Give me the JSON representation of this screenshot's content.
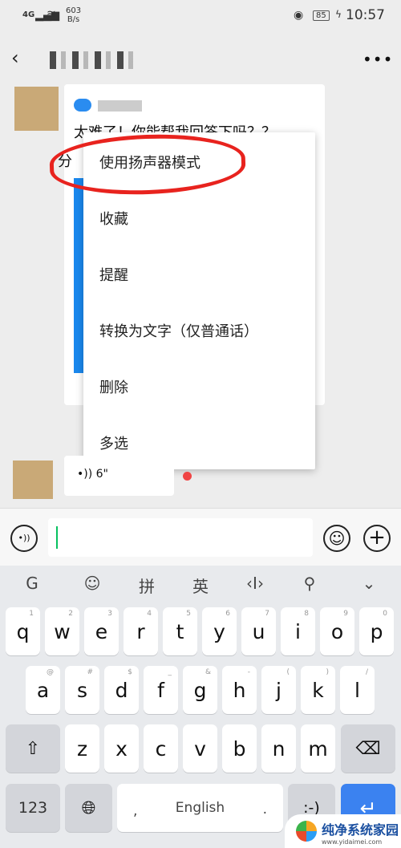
{
  "status_bar": {
    "network": "4G",
    "speed_value": "603",
    "speed_unit": "B/s",
    "battery": "85",
    "time": "10:57"
  },
  "header": {
    "back_icon": "chevron-left",
    "more_icon": "more-horizontal"
  },
  "chat": {
    "message_text": "太难了！你能帮我回答下吗？？",
    "message_prefix": "分",
    "voice_duration": "6\"",
    "unread_dot_color": "#f04545"
  },
  "context_menu": {
    "items": [
      "使用扬声器模式",
      "收藏",
      "提醒",
      "转换为文字（仅普通话）",
      "删除",
      "多选"
    ],
    "highlight_color": "#e8231e"
  },
  "input_bar": {
    "value": ""
  },
  "keyboard": {
    "toolbar": [
      "G",
      "☺",
      "拼",
      "英",
      "‹I›",
      "⚲",
      "⌄"
    ],
    "row1": [
      [
        "q",
        "1"
      ],
      [
        "w",
        "2"
      ],
      [
        "e",
        "3"
      ],
      [
        "r",
        "4"
      ],
      [
        "t",
        "5"
      ],
      [
        "y",
        "6"
      ],
      [
        "u",
        "7"
      ],
      [
        "i",
        "8"
      ],
      [
        "o",
        "9"
      ],
      [
        "p",
        "0"
      ]
    ],
    "row2": [
      [
        "a",
        "@"
      ],
      [
        "s",
        "#"
      ],
      [
        "d",
        "$"
      ],
      [
        "f",
        "_"
      ],
      [
        "g",
        "&"
      ],
      [
        "h",
        "-"
      ],
      [
        "j",
        "("
      ],
      [
        "k",
        ")"
      ],
      [
        "l",
        "/"
      ]
    ],
    "row3": [
      "z",
      "x",
      "c",
      "v",
      "b",
      "n",
      "m"
    ],
    "numbers_label": "123",
    "space_label": "English",
    "comma": ",",
    "period": ".",
    "emoticon_label": ":-)",
    "accent_color": "#3b82f0"
  },
  "watermark": {
    "title": "纯净系统家园",
    "url": "www.yidaimei.com"
  }
}
